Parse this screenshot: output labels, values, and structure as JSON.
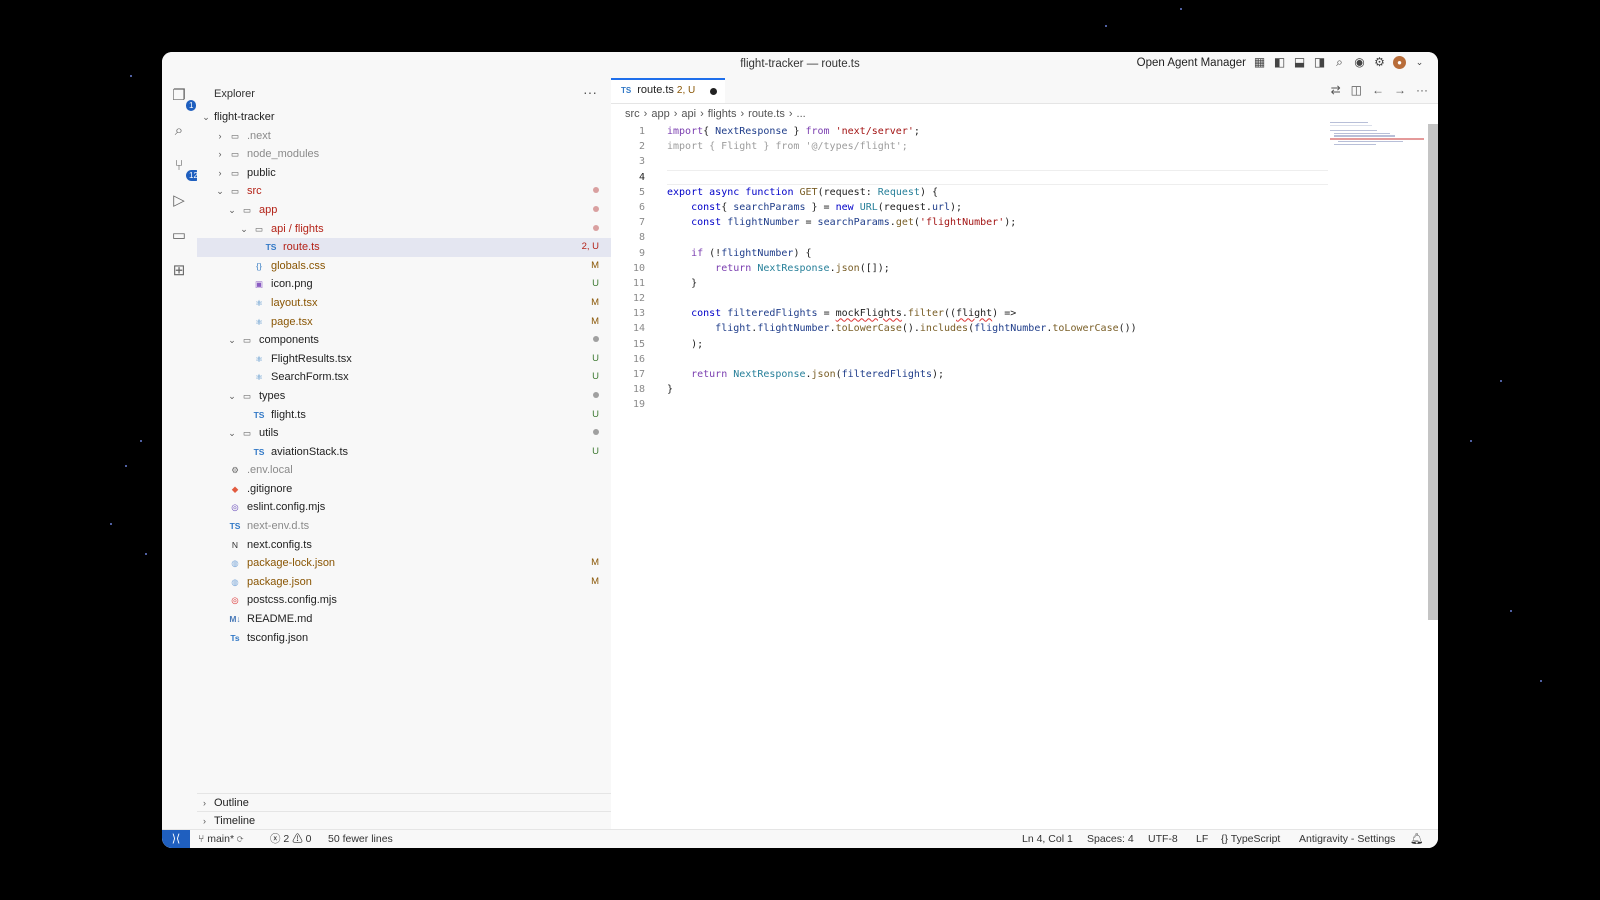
{
  "window": {
    "title": "flight-tracker — route.ts"
  },
  "titlebar": {
    "agent_manager": "Open Agent Manager",
    "icons": [
      "layout-grid-icon",
      "toggle-sidebar-icon",
      "toggle-panel-icon",
      "toggle-secondary-sidebar-icon",
      "search-icon",
      "account-status-icon",
      "settings-gear-icon",
      "avatar-icon"
    ]
  },
  "activity_bar": {
    "items": [
      {
        "name": "explorer-icon",
        "badge": "1"
      },
      {
        "name": "search-icon",
        "badge": ""
      },
      {
        "name": "source-control-icon",
        "badge": "12"
      },
      {
        "name": "run-debug-icon",
        "badge": ""
      },
      {
        "name": "remote-explorer-icon",
        "badge": ""
      },
      {
        "name": "extensions-icon",
        "badge": ""
      }
    ]
  },
  "explorer": {
    "title": "Explorer",
    "more": "···",
    "root": "flight-tracker",
    "items": [
      {
        "label": ".next",
        "depth": 1,
        "kind": "folder",
        "open": false,
        "status": "",
        "dim": true
      },
      {
        "label": "node_modules",
        "depth": 1,
        "kind": "folder",
        "open": false,
        "status": "",
        "dim": true
      },
      {
        "label": "public",
        "depth": 1,
        "kind": "folder",
        "open": false,
        "status": ""
      },
      {
        "label": "src",
        "depth": 1,
        "kind": "folder",
        "open": true,
        "status": "dot-red",
        "color": "red"
      },
      {
        "label": "app",
        "depth": 2,
        "kind": "folder",
        "open": true,
        "status": "dot-red",
        "color": "red"
      },
      {
        "label": "api / flights",
        "depth": 3,
        "kind": "folder",
        "open": true,
        "status": "dot-red",
        "color": "red"
      },
      {
        "label": "route.ts",
        "depth": 4,
        "kind": "ts",
        "status": "2, U",
        "color": "red",
        "selected": true
      },
      {
        "label": "globals.css",
        "depth": 3,
        "kind": "css",
        "status": "M",
        "color": "mod"
      },
      {
        "label": "icon.png",
        "depth": 3,
        "kind": "img",
        "status": "U",
        "color": "new"
      },
      {
        "label": "layout.tsx",
        "depth": 3,
        "kind": "react",
        "status": "M",
        "color": "mod"
      },
      {
        "label": "page.tsx",
        "depth": 3,
        "kind": "react",
        "status": "M",
        "color": "mod"
      },
      {
        "label": "components",
        "depth": 2,
        "kind": "folder",
        "open": true,
        "status": "dot-gray"
      },
      {
        "label": "FlightResults.tsx",
        "depth": 3,
        "kind": "react",
        "status": "U",
        "color": "new"
      },
      {
        "label": "SearchForm.tsx",
        "depth": 3,
        "kind": "react",
        "status": "U",
        "color": "new"
      },
      {
        "label": "types",
        "depth": 2,
        "kind": "folder",
        "open": true,
        "status": "dot-gray"
      },
      {
        "label": "flight.ts",
        "depth": 3,
        "kind": "ts",
        "status": "U",
        "color": "new"
      },
      {
        "label": "utils",
        "depth": 2,
        "kind": "folder",
        "open": true,
        "status": "dot-gray"
      },
      {
        "label": "aviationStack.ts",
        "depth": 3,
        "kind": "ts",
        "status": "U",
        "color": "new"
      },
      {
        "label": ".env.local",
        "depth": 1,
        "kind": "gear",
        "status": "",
        "dim": true
      },
      {
        "label": ".gitignore",
        "depth": 1,
        "kind": "git",
        "status": ""
      },
      {
        "label": "eslint.config.mjs",
        "depth": 1,
        "kind": "eslint",
        "status": ""
      },
      {
        "label": "next-env.d.ts",
        "depth": 1,
        "kind": "ts",
        "status": "",
        "dim": true
      },
      {
        "label": "next.config.ts",
        "depth": 1,
        "kind": "next",
        "status": ""
      },
      {
        "label": "package-lock.json",
        "depth": 1,
        "kind": "json",
        "status": "M",
        "color": "mod"
      },
      {
        "label": "package.json",
        "depth": 1,
        "kind": "json",
        "status": "M",
        "color": "mod"
      },
      {
        "label": "postcss.config.mjs",
        "depth": 1,
        "kind": "postcss",
        "status": ""
      },
      {
        "label": "README.md",
        "depth": 1,
        "kind": "md",
        "status": ""
      },
      {
        "label": "tsconfig.json",
        "depth": 1,
        "kind": "tsconfig",
        "status": ""
      }
    ],
    "outline": "Outline",
    "timeline": "Timeline"
  },
  "editor": {
    "tab": {
      "icon": "TS",
      "label": "route.ts",
      "status": "2, U"
    },
    "breadcrumb": [
      "src",
      "app",
      "api",
      "flights",
      "route.ts",
      "..."
    ],
    "cursor_line": 4,
    "lines": [
      [
        [
          "kw2",
          "import"
        ],
        [
          "",
          "{ "
        ],
        [
          "var",
          "NextResponse"
        ],
        [
          "",
          " } "
        ],
        [
          "kw2",
          "from"
        ],
        [
          "str",
          " 'next/server'"
        ],
        [
          "",
          ";"
        ]
      ],
      [
        [
          "faded",
          "import { Flight } from '@/types/flight';"
        ]
      ],
      [],
      [],
      [
        [
          "kw",
          "export"
        ],
        [
          "",
          " "
        ],
        [
          "kw",
          "async"
        ],
        [
          "",
          " "
        ],
        [
          "kw",
          "function"
        ],
        [
          "",
          " "
        ],
        [
          "fn",
          "GET"
        ],
        [
          "",
          "(request: "
        ],
        [
          "typ",
          "Request"
        ],
        [
          "",
          ") {"
        ]
      ],
      [
        [
          "",
          "    "
        ],
        [
          "kw",
          "const"
        ],
        [
          "",
          "{ "
        ],
        [
          "var",
          "searchParams"
        ],
        [
          "",
          " } = "
        ],
        [
          "kw",
          "new"
        ],
        [
          "",
          " "
        ],
        [
          "typ",
          "URL"
        ],
        [
          "",
          "(request."
        ],
        [
          "var",
          "url"
        ],
        [
          "",
          ");"
        ]
      ],
      [
        [
          "",
          "    "
        ],
        [
          "kw",
          "const"
        ],
        [
          "",
          " "
        ],
        [
          "var",
          "flightNumber"
        ],
        [
          "",
          " = "
        ],
        [
          "var",
          "searchParams"
        ],
        [
          "",
          "."
        ],
        [
          "fn",
          "get"
        ],
        [
          "",
          "("
        ],
        [
          "str",
          "'flightNumber'"
        ],
        [
          "",
          ");"
        ]
      ],
      [],
      [
        [
          "",
          "    "
        ],
        [
          "kw2",
          "if"
        ],
        [
          "",
          " (!"
        ],
        [
          "var",
          "flightNumber"
        ],
        [
          "",
          ") {"
        ]
      ],
      [
        [
          "",
          "        "
        ],
        [
          "kw2",
          "return"
        ],
        [
          "",
          " "
        ],
        [
          "typ",
          "NextResponse"
        ],
        [
          "",
          "."
        ],
        [
          "fn",
          "json"
        ],
        [
          "",
          "([]);"
        ]
      ],
      [
        [
          "",
          "    }"
        ]
      ],
      [],
      [
        [
          "",
          "    "
        ],
        [
          "kw",
          "const"
        ],
        [
          "",
          " "
        ],
        [
          "var",
          "filteredFlights"
        ],
        [
          "",
          " = "
        ],
        [
          "squig",
          "mockFlights"
        ],
        [
          "",
          "."
        ],
        [
          "fn",
          "filter"
        ],
        [
          "",
          "(("
        ],
        [
          "squig",
          "flight"
        ],
        [
          "",
          ") =>"
        ]
      ],
      [
        [
          "",
          "        "
        ],
        [
          "var",
          "flight"
        ],
        [
          "",
          "."
        ],
        [
          "var",
          "flightNumber"
        ],
        [
          "",
          "."
        ],
        [
          "fn",
          "toLowerCase"
        ],
        [
          "",
          "()."
        ],
        [
          "fn",
          "includes"
        ],
        [
          "",
          "("
        ],
        [
          "var",
          "flightNumber"
        ],
        [
          "",
          "."
        ],
        [
          "fn",
          "toLowerCase"
        ],
        [
          "",
          "())"
        ]
      ],
      [
        [
          "",
          "    );"
        ]
      ],
      [],
      [
        [
          "",
          "    "
        ],
        [
          "kw2",
          "return"
        ],
        [
          "",
          " "
        ],
        [
          "typ",
          "NextResponse"
        ],
        [
          "",
          "."
        ],
        [
          "fn",
          "json"
        ],
        [
          "",
          "("
        ],
        [
          "var",
          "filteredFlights"
        ],
        [
          "",
          ");"
        ]
      ],
      [
        [
          "",
          "}"
        ]
      ],
      []
    ]
  },
  "statusbar": {
    "branch": "main*",
    "errors": "2",
    "warnings": "0",
    "diff": "50 fewer lines",
    "position": "Ln 4, Col 1",
    "spaces": "Spaces: 4",
    "encoding": "UTF-8",
    "eol": "LF",
    "language": "TypeScript",
    "settings": "Antigravity - Settings"
  },
  "colors": {
    "accent": "#1f5fbf",
    "modified": "#895503",
    "untracked": "#3e7a32",
    "error": "#b42318"
  }
}
